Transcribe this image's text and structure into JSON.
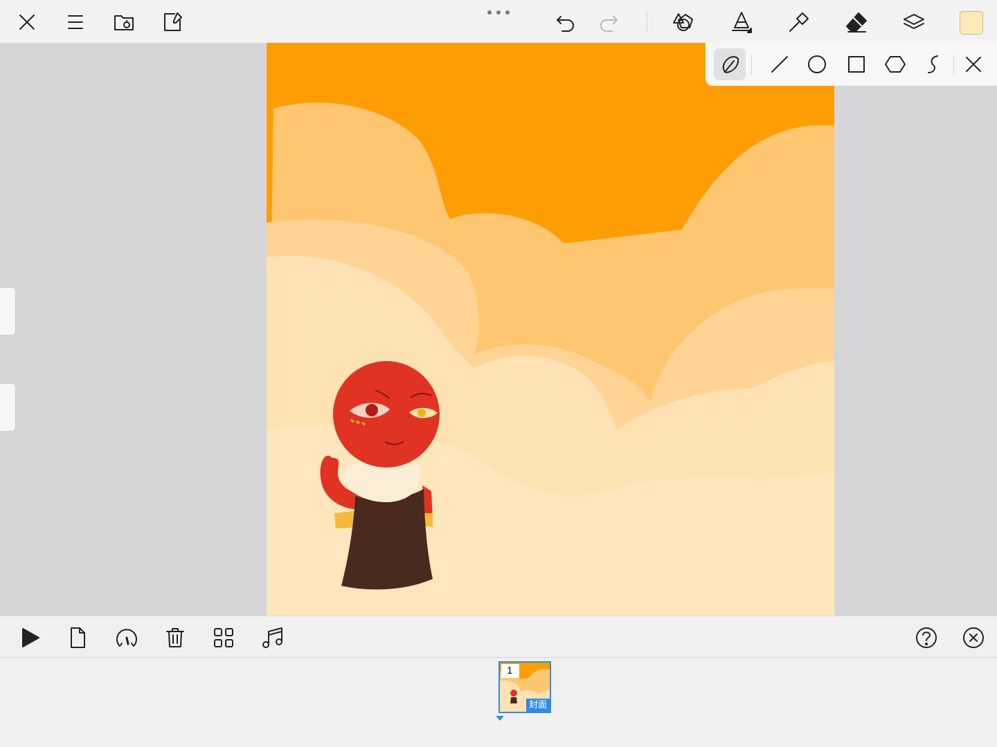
{
  "top_toolbar": {
    "left_tools": [
      "close-icon",
      "menu-icon",
      "open-folder-icon",
      "export-icon"
    ],
    "history_tools": [
      "undo-icon",
      "redo-icon"
    ],
    "right_tools": [
      "shapes-icon",
      "pen-tool-icon",
      "paint-bucket-icon",
      "eraser-icon",
      "layers-icon"
    ],
    "current_color": "#fde9b6"
  },
  "shape_tools": {
    "items": [
      "freehand-shape-icon",
      "line-icon",
      "circle-icon",
      "rectangle-icon",
      "polygon-icon",
      "curve-icon"
    ],
    "active": "freehand-shape-icon",
    "close": "close-icon"
  },
  "canvas": {
    "colors": {
      "sky": "#ff9d05",
      "cloud_back": "#ffc672",
      "cloud_mid": "#ffd495",
      "cloud_front": "#ffe2b3",
      "character_head": "#e13324",
      "character_body": "#4a2a1e"
    }
  },
  "playback_bar": {
    "left_tools": [
      "play-icon",
      "new-frame-icon",
      "speed-icon",
      "delete-icon",
      "grid-icon",
      "music-icon"
    ],
    "right_tools": [
      "help-icon",
      "close-circle-icon"
    ]
  },
  "frames": [
    {
      "number": "1",
      "label": "封面"
    }
  ]
}
